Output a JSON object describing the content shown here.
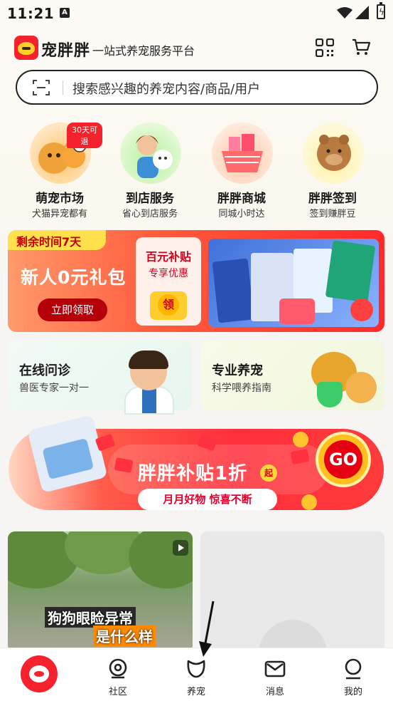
{
  "status_bar": {
    "time": "11:21",
    "notification_icon": "a-icon"
  },
  "header": {
    "brand": "宠胖胖",
    "slogan": "一站式养宠服务平台",
    "qr_icon": "qr-code-icon",
    "cart_icon": "cart-icon"
  },
  "search": {
    "placeholder": "搜索感兴趣的养宠内容/商品/用户"
  },
  "quick_menu": [
    {
      "title": "萌宠市场",
      "subtitle": "犬猫异宠都有",
      "badge": "30天可退"
    },
    {
      "title": "到店服务",
      "subtitle": "省心到店服务"
    },
    {
      "title": "胖胖商城",
      "subtitle": "同城小时达"
    },
    {
      "title": "胖胖签到",
      "subtitle": "签到赚胖豆"
    }
  ],
  "new_user_banner": {
    "time_tag": "剩余时间7天",
    "title": "新人0元礼包",
    "button": "立即领取",
    "card_title": "百元补贴",
    "card_sub": "专享优惠",
    "coin_text": "领"
  },
  "services": [
    {
      "title": "在线问诊",
      "subtitle": "兽医专家一对一"
    },
    {
      "title": "专业养宠",
      "subtitle": "科学喂养指南"
    }
  ],
  "promo": {
    "title": "胖胖补贴1折",
    "title_badge": "起",
    "subtitle": "月月好物 惊喜不断",
    "go": "GO"
  },
  "feed": {
    "caption_1": "狗狗眼睑异常",
    "caption_2": "是什么样"
  },
  "tabs": [
    {
      "label": ""
    },
    {
      "label": "社区"
    },
    {
      "label": "养宠"
    },
    {
      "label": "消息"
    },
    {
      "label": "我的"
    }
  ],
  "colors": {
    "brand_red": "#f5222d",
    "brand_yellow": "#ffcf2b"
  }
}
